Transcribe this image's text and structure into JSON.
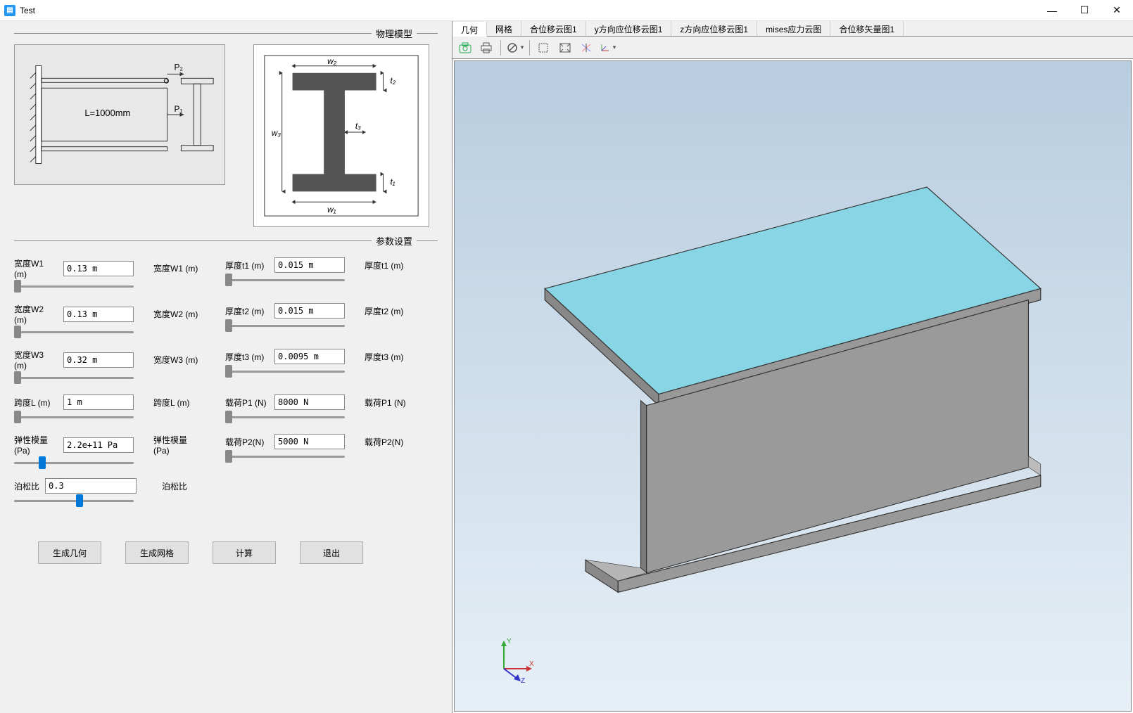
{
  "window": {
    "title": "Test"
  },
  "sections": {
    "physical_model": "物理模型",
    "param_settings": "参数设置"
  },
  "params": {
    "W1": {
      "label": "宽度W1 (m)",
      "value": "0.13 m",
      "unit": "宽度W1 (m)"
    },
    "W2": {
      "label": "宽度W2 (m)",
      "value": "0.13 m",
      "unit": "宽度W2 (m)"
    },
    "W3": {
      "label": "宽度W3 (m)",
      "value": "0.32 m",
      "unit": "宽度W3 (m)"
    },
    "L": {
      "label": "跨度L (m)",
      "value": "1 m",
      "unit": "跨度L (m)"
    },
    "E": {
      "label": "弹性模量 (Pa)",
      "value": "2.2e+11 Pa",
      "unit": "弹性模量 (Pa)"
    },
    "t1": {
      "label": "厚度t1 (m)",
      "value": "0.015 m",
      "unit": "厚度t1 (m)"
    },
    "t2": {
      "label": "厚度t2 (m)",
      "value": "0.015 m",
      "unit": "厚度t2 (m)"
    },
    "t3": {
      "label": "厚度t3 (m)",
      "value": "0.0095 m",
      "unit": "厚度t3 (m)"
    },
    "P1": {
      "label": "载荷P1 (N)",
      "value": "8000 N",
      "unit": "载荷P1 (N)"
    },
    "P2": {
      "label": "载荷P2(N)",
      "value": "5000 N",
      "unit": "载荷P2(N)"
    },
    "nu": {
      "label": "泊松比",
      "value": "0.3",
      "unit": "泊松比"
    }
  },
  "diagram_labels": {
    "L": "L=1000mm",
    "O": "O",
    "P1": "P₁",
    "P2": "P₂",
    "w1": "w₁",
    "w2": "w₂",
    "w3": "w₃",
    "t1": "t₁",
    "t2": "t₂",
    "t3": "t₃"
  },
  "buttons": {
    "gen_geometry": "生成几何",
    "gen_mesh": "生成网格",
    "calculate": "计算",
    "exit": "退出"
  },
  "view_tabs": [
    "几何",
    "网格",
    "合位移云图1",
    "y方向应位移云图1",
    "z方向应位移云图1",
    "mises应力云图",
    "合位移矢量图1"
  ],
  "active_tab": 0,
  "triad": {
    "x": "X",
    "y": "Y",
    "z": "Z"
  }
}
